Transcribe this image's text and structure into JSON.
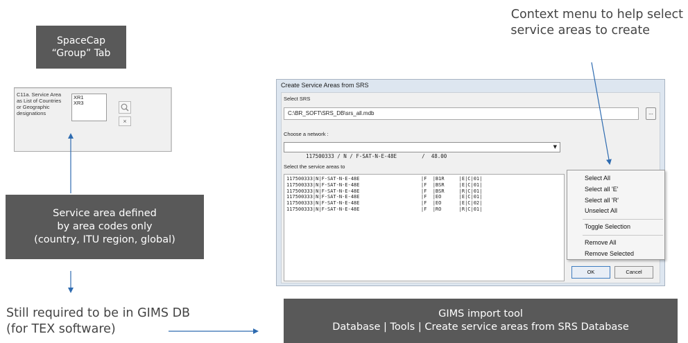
{
  "spacecap_box": {
    "line1": "SpaceCap",
    "line2": "“Group” Tab"
  },
  "c11a_panel": {
    "label_lines": [
      "C11a.  Service Area",
      "as List of Countries",
      "or Geographic",
      "designations"
    ],
    "list_values": [
      "XR1",
      "XR3"
    ],
    "search_icon": "magnifier-icon",
    "clear_button": "×"
  },
  "service_area_box": {
    "line1": "Service area defined",
    "line2": "by area codes only",
    "line3": "(country, ITU region, global)"
  },
  "still_required": {
    "line1": "Still required to be in GIMS DB",
    "line2": "(for TEX software)"
  },
  "context_caption": {
    "line1": "Context menu to help select",
    "line2": "service areas to create"
  },
  "gims_tool_box": {
    "line1": "GIMS import tool",
    "line2": "Database | Tools | Create service areas from SRS Database"
  },
  "dialog": {
    "title": "Create Service Areas from SRS",
    "select_srs_label": "Select SRS",
    "srs_path": "C:\\BR_SOFT\\SRS_DB\\srs_all.mdb",
    "browse_button": "...",
    "choose_network_label": "Choose a network :",
    "network_value": "117500333 / N / F-SAT-N-E-48E        /  48.00",
    "select_areas_label": "Select the service areas to",
    "areas": [
      "117500333|N|F-SAT-N-E-48E                     |F  |B1R     |E|C|01|",
      "117500333|N|F-SAT-N-E-48E                     |F  |BSR     |E|C|01|",
      "117500333|N|F-SAT-N-E-48E                     |F  |BSR     |R|C|01|",
      "117500333|N|F-SAT-N-E-48E                     |F  |EO      |E|C|01|",
      "117500333|N|F-SAT-N-E-48E                     |F  |EO      |E|C|02|",
      "117500333|N|F-SAT-N-E-48E                     |F  |RO      |R|C|01|"
    ],
    "ok_button": "OK",
    "cancel_button": "Cancel"
  },
  "context_menu": {
    "items": [
      "Select All",
      "Select all 'E'",
      "Select all 'R'",
      "Unselect All",
      "Toggle Selection",
      "Remove All",
      "Remove Selected"
    ]
  },
  "colors": {
    "box_fill": "#595959",
    "box_text": "#ffffff",
    "arrow": "#2e6bb0",
    "dialog_frame": "#dde6f0"
  }
}
